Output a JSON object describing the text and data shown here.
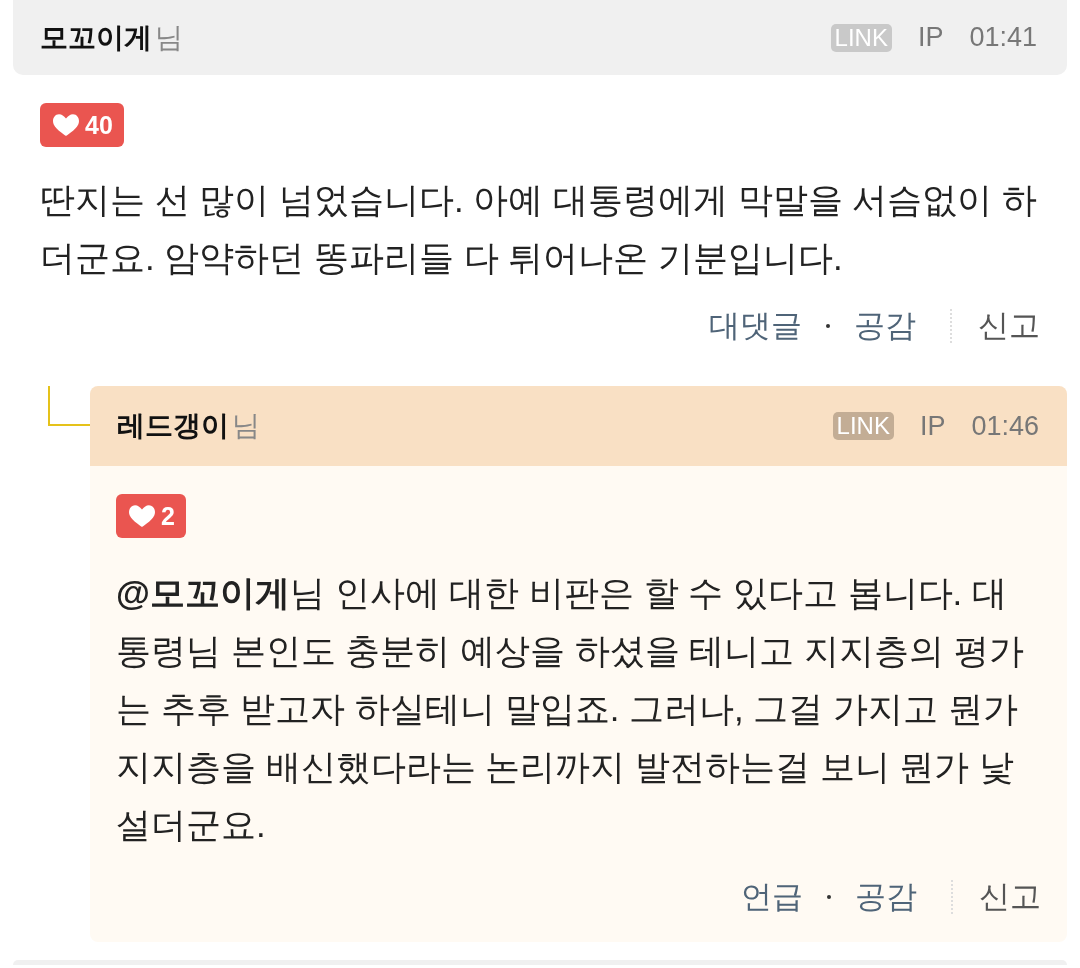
{
  "comments": [
    {
      "author": "모꼬이게",
      "honorific": "님",
      "link_badge": "LINK",
      "ip_label": "IP",
      "time": "01:41",
      "likes": "40",
      "text": "딴지는 선 많이 넘었습니다. 아예 대통령에게 막말을 서슴없이 하더군요. 암약하던 똥파리들 다 튀어나온 기분입니다.",
      "actions": [
        {
          "label": "대댓글",
          "kind": "reply"
        },
        {
          "label": "공감",
          "kind": "like"
        },
        {
          "label": "신고",
          "kind": "report"
        }
      ],
      "replies": [
        {
          "author": "레드갱이",
          "honorific": "님",
          "link_badge": "LINK",
          "ip_label": "IP",
          "time": "01:46",
          "likes": "2",
          "text": "**@모꼬이게**님 인사에 대한 비판은 할 수 있다고 봅니다. 대통령님 본인도 충분히 예상을 하셨을 테니고 지지층의 평가는 추후 받고자 하실테니 말입죠. 그러나, 그걸 가지고 뭔가 지지층을 배신했다라는 논리까지 발전하는걸 보니 뭔가 낯설더군요.",
          "actions": [
            {
              "label": "언급",
              "kind": "mention"
            },
            {
              "label": "공감",
              "kind": "like"
            },
            {
              "label": "신고",
              "kind": "report"
            }
          ]
        }
      ]
    }
  ]
}
